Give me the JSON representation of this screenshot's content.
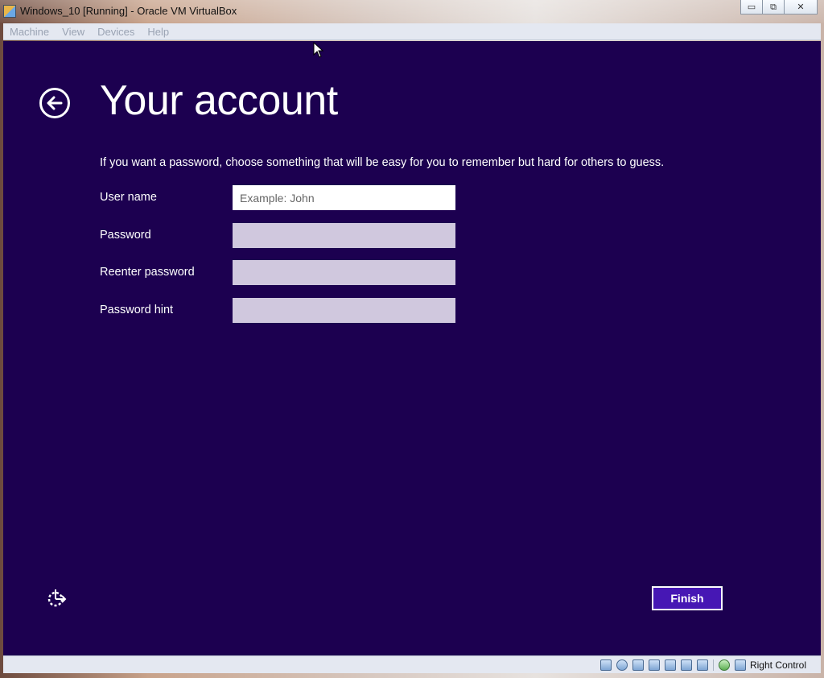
{
  "window": {
    "title": "Windows_10 [Running] - Oracle VM VirtualBox",
    "controls": {
      "minimize": "▭",
      "restore": "⧉",
      "close": "✕"
    }
  },
  "menubar": {
    "items": [
      "Machine",
      "View",
      "Devices",
      "Help"
    ]
  },
  "setup": {
    "title": "Your account",
    "instruction": "If you want a password, choose something that will be easy for you to remember but hard for others to guess.",
    "fields": [
      {
        "label": "User name",
        "placeholder": "Example: John",
        "value": ""
      },
      {
        "label": "Password",
        "placeholder": "",
        "value": ""
      },
      {
        "label": "Reenter password",
        "placeholder": "",
        "value": ""
      },
      {
        "label": "Password hint",
        "placeholder": "",
        "value": ""
      }
    ],
    "finish_label": "Finish",
    "colors": {
      "background": "#1c0050",
      "button": "#4617b4",
      "inactive_input": "#d0c8de"
    }
  },
  "statusbar": {
    "host_key": "Right Control",
    "icons": [
      "hard-disk-icon",
      "optical-drive-icon",
      "usb-icon",
      "shared-folders-icon",
      "display-icon",
      "network-icon",
      "video-capture-icon",
      "guest-additions-icon",
      "mouse-integration-icon"
    ]
  }
}
